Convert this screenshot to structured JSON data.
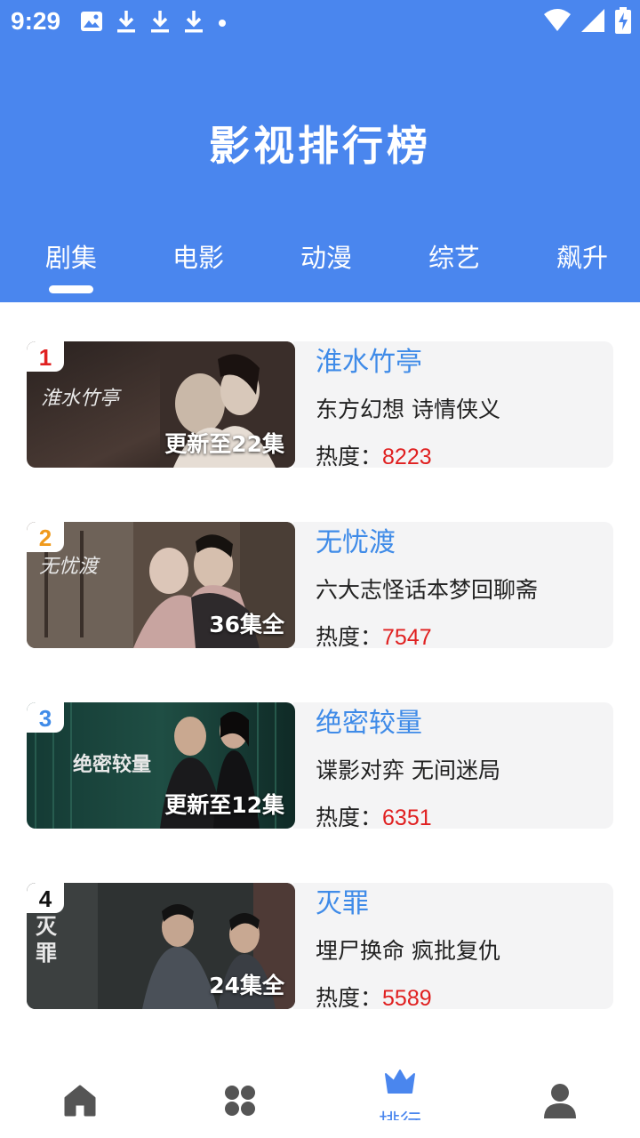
{
  "status_bar": {
    "time": "9:29",
    "left_icons": [
      "image-icon",
      "download-icon",
      "download-icon",
      "download-icon",
      "dot-icon"
    ],
    "right_icons": [
      "wifi-icon",
      "signal-icon",
      "battery-charging-icon"
    ]
  },
  "header": {
    "title": "影视排行榜",
    "background_color": "#4a86ee"
  },
  "tabs": [
    {
      "label": "剧集",
      "selected": true
    },
    {
      "label": "电影",
      "selected": false
    },
    {
      "label": "动漫",
      "selected": false
    },
    {
      "label": "综艺",
      "selected": false
    },
    {
      "label": "飙升",
      "selected": false
    }
  ],
  "list": [
    {
      "rank": "1",
      "rank_color": "#e02020",
      "title": "淮水竹亭",
      "tags": "东方幻想 诗情侠义",
      "heat_label": "热度：",
      "heat_value": "8223",
      "episodes": "更新至22集",
      "poster_text": "淮水竹亭"
    },
    {
      "rank": "2",
      "rank_color": "#f09a1c",
      "title": "无忧渡",
      "tags": "六大志怪话本梦回聊斋",
      "heat_label": "热度：",
      "heat_value": "7547",
      "episodes": "36集全",
      "poster_text": "无忧渡"
    },
    {
      "rank": "3",
      "rank_color": "#3f8be8",
      "title": "绝密较量",
      "tags": "谍影对弈 无间迷局",
      "heat_label": "热度：",
      "heat_value": "6351",
      "episodes": "更新至12集",
      "poster_text": "绝密较量"
    },
    {
      "rank": "4",
      "rank_color": "#111111",
      "title": "灭罪",
      "tags": "埋尸换命 疯批复仇",
      "heat_label": "热度：",
      "heat_value": "5589",
      "episodes": "24集全",
      "poster_text": "灭罪"
    }
  ],
  "bottom_nav": [
    {
      "icon": "home-icon",
      "label": "",
      "active": false
    },
    {
      "icon": "grid-icon",
      "label": "",
      "active": false
    },
    {
      "icon": "crown-icon",
      "label": "排行",
      "active": true
    },
    {
      "icon": "user-icon",
      "label": "",
      "active": false
    }
  ],
  "colors": {
    "accent": "#4a86ee",
    "title_blue": "#3f8be8",
    "heat_red": "#e02020",
    "inactive_icon": "#555555"
  }
}
